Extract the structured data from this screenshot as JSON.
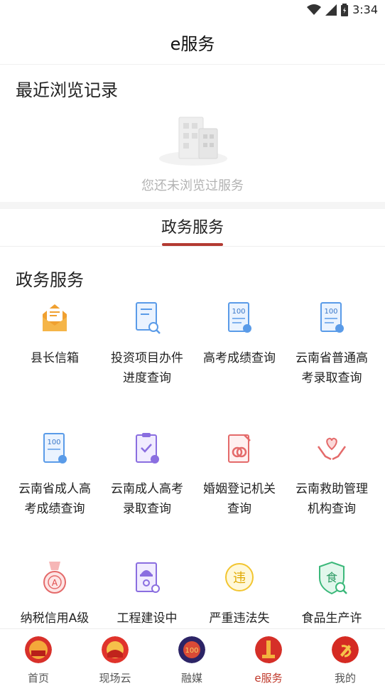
{
  "status_bar": {
    "time": "3:34"
  },
  "header": {
    "title": "e服务"
  },
  "recent": {
    "title": "最近浏览记录",
    "empty_text": "您还未浏览过服务"
  },
  "tabs": [
    {
      "label": "政务服务",
      "active": true
    }
  ],
  "section": {
    "title": "政务服务"
  },
  "services": [
    {
      "label": "县长信箱",
      "icon": "mailbox-icon"
    },
    {
      "label": "投资项目办件进度查询",
      "icon": "document-search-icon"
    },
    {
      "label": "高考成绩查询",
      "icon": "score-report-icon"
    },
    {
      "label": "云南省普通高考录取查询",
      "icon": "admission-report-icon"
    },
    {
      "label": "云南省成人高考成绩查询",
      "icon": "adult-score-icon"
    },
    {
      "label": "云南成人高考录取查询",
      "icon": "clipboard-check-icon"
    },
    {
      "label": "婚姻登记机关查询",
      "icon": "marriage-icon"
    },
    {
      "label": "云南救助管理机构查询",
      "icon": "heart-hands-icon"
    },
    {
      "label": "纳税信用A级",
      "icon": "medal-a-icon"
    },
    {
      "label": "工程建设中",
      "icon": "construction-icon"
    },
    {
      "label": "严重违法失",
      "icon": "violation-icon"
    },
    {
      "label": "食品生产许",
      "icon": "food-shield-icon"
    }
  ],
  "bottom_nav": [
    {
      "label": "首页",
      "active": false
    },
    {
      "label": "现场云",
      "active": false
    },
    {
      "label": "融媒",
      "active": false
    },
    {
      "label": "e服务",
      "active": true
    },
    {
      "label": "我的",
      "active": false
    }
  ],
  "colors": {
    "accent": "#b33a32",
    "active_nav": "#c0392b"
  }
}
